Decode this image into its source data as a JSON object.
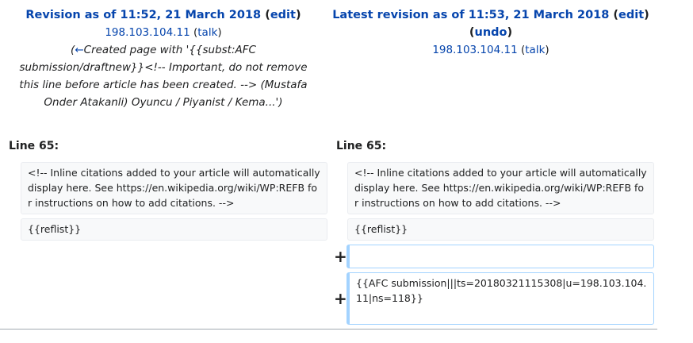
{
  "left": {
    "title_prefix": "Revision as of 11:52, 21 March 2018",
    "edit_link": "edit",
    "user": "198.103.104.11",
    "talk_link": "talk",
    "summary_arrow": "←",
    "summary_text": "Created page with '{{subst:AFC submission/draftnew}}<!-- Important, do not remove this line before article has been created. --> (Mustafa Onder Atakanli) Oyuncu / Piyanist / Kema...'",
    "line_label": "Line 65:",
    "blocks": [
      "<!-- Inline citations added to your article will automatically display here. See https://en.wikipedia.org/wiki/WP:REFB for instructions on how to add citations. -->",
      "{{reflist}}"
    ]
  },
  "right": {
    "title_prefix": "Latest revision as of 11:53, 21 March 2018",
    "edit_link": "edit",
    "undo_link": "undo",
    "user": "198.103.104.11",
    "talk_link": "talk",
    "line_label": "Line 65:",
    "blocks": [
      "<!-- Inline citations added to your article will automatically display here. See https://en.wikipedia.org/wiki/WP:REFB for instructions on how to add citations. -->",
      "{{reflist}}"
    ],
    "added_marker": "+",
    "added_blocks": [
      "",
      "{{AFC submission|||ts=20180321115308|u=198.103.104.11|ns=118}}"
    ]
  }
}
